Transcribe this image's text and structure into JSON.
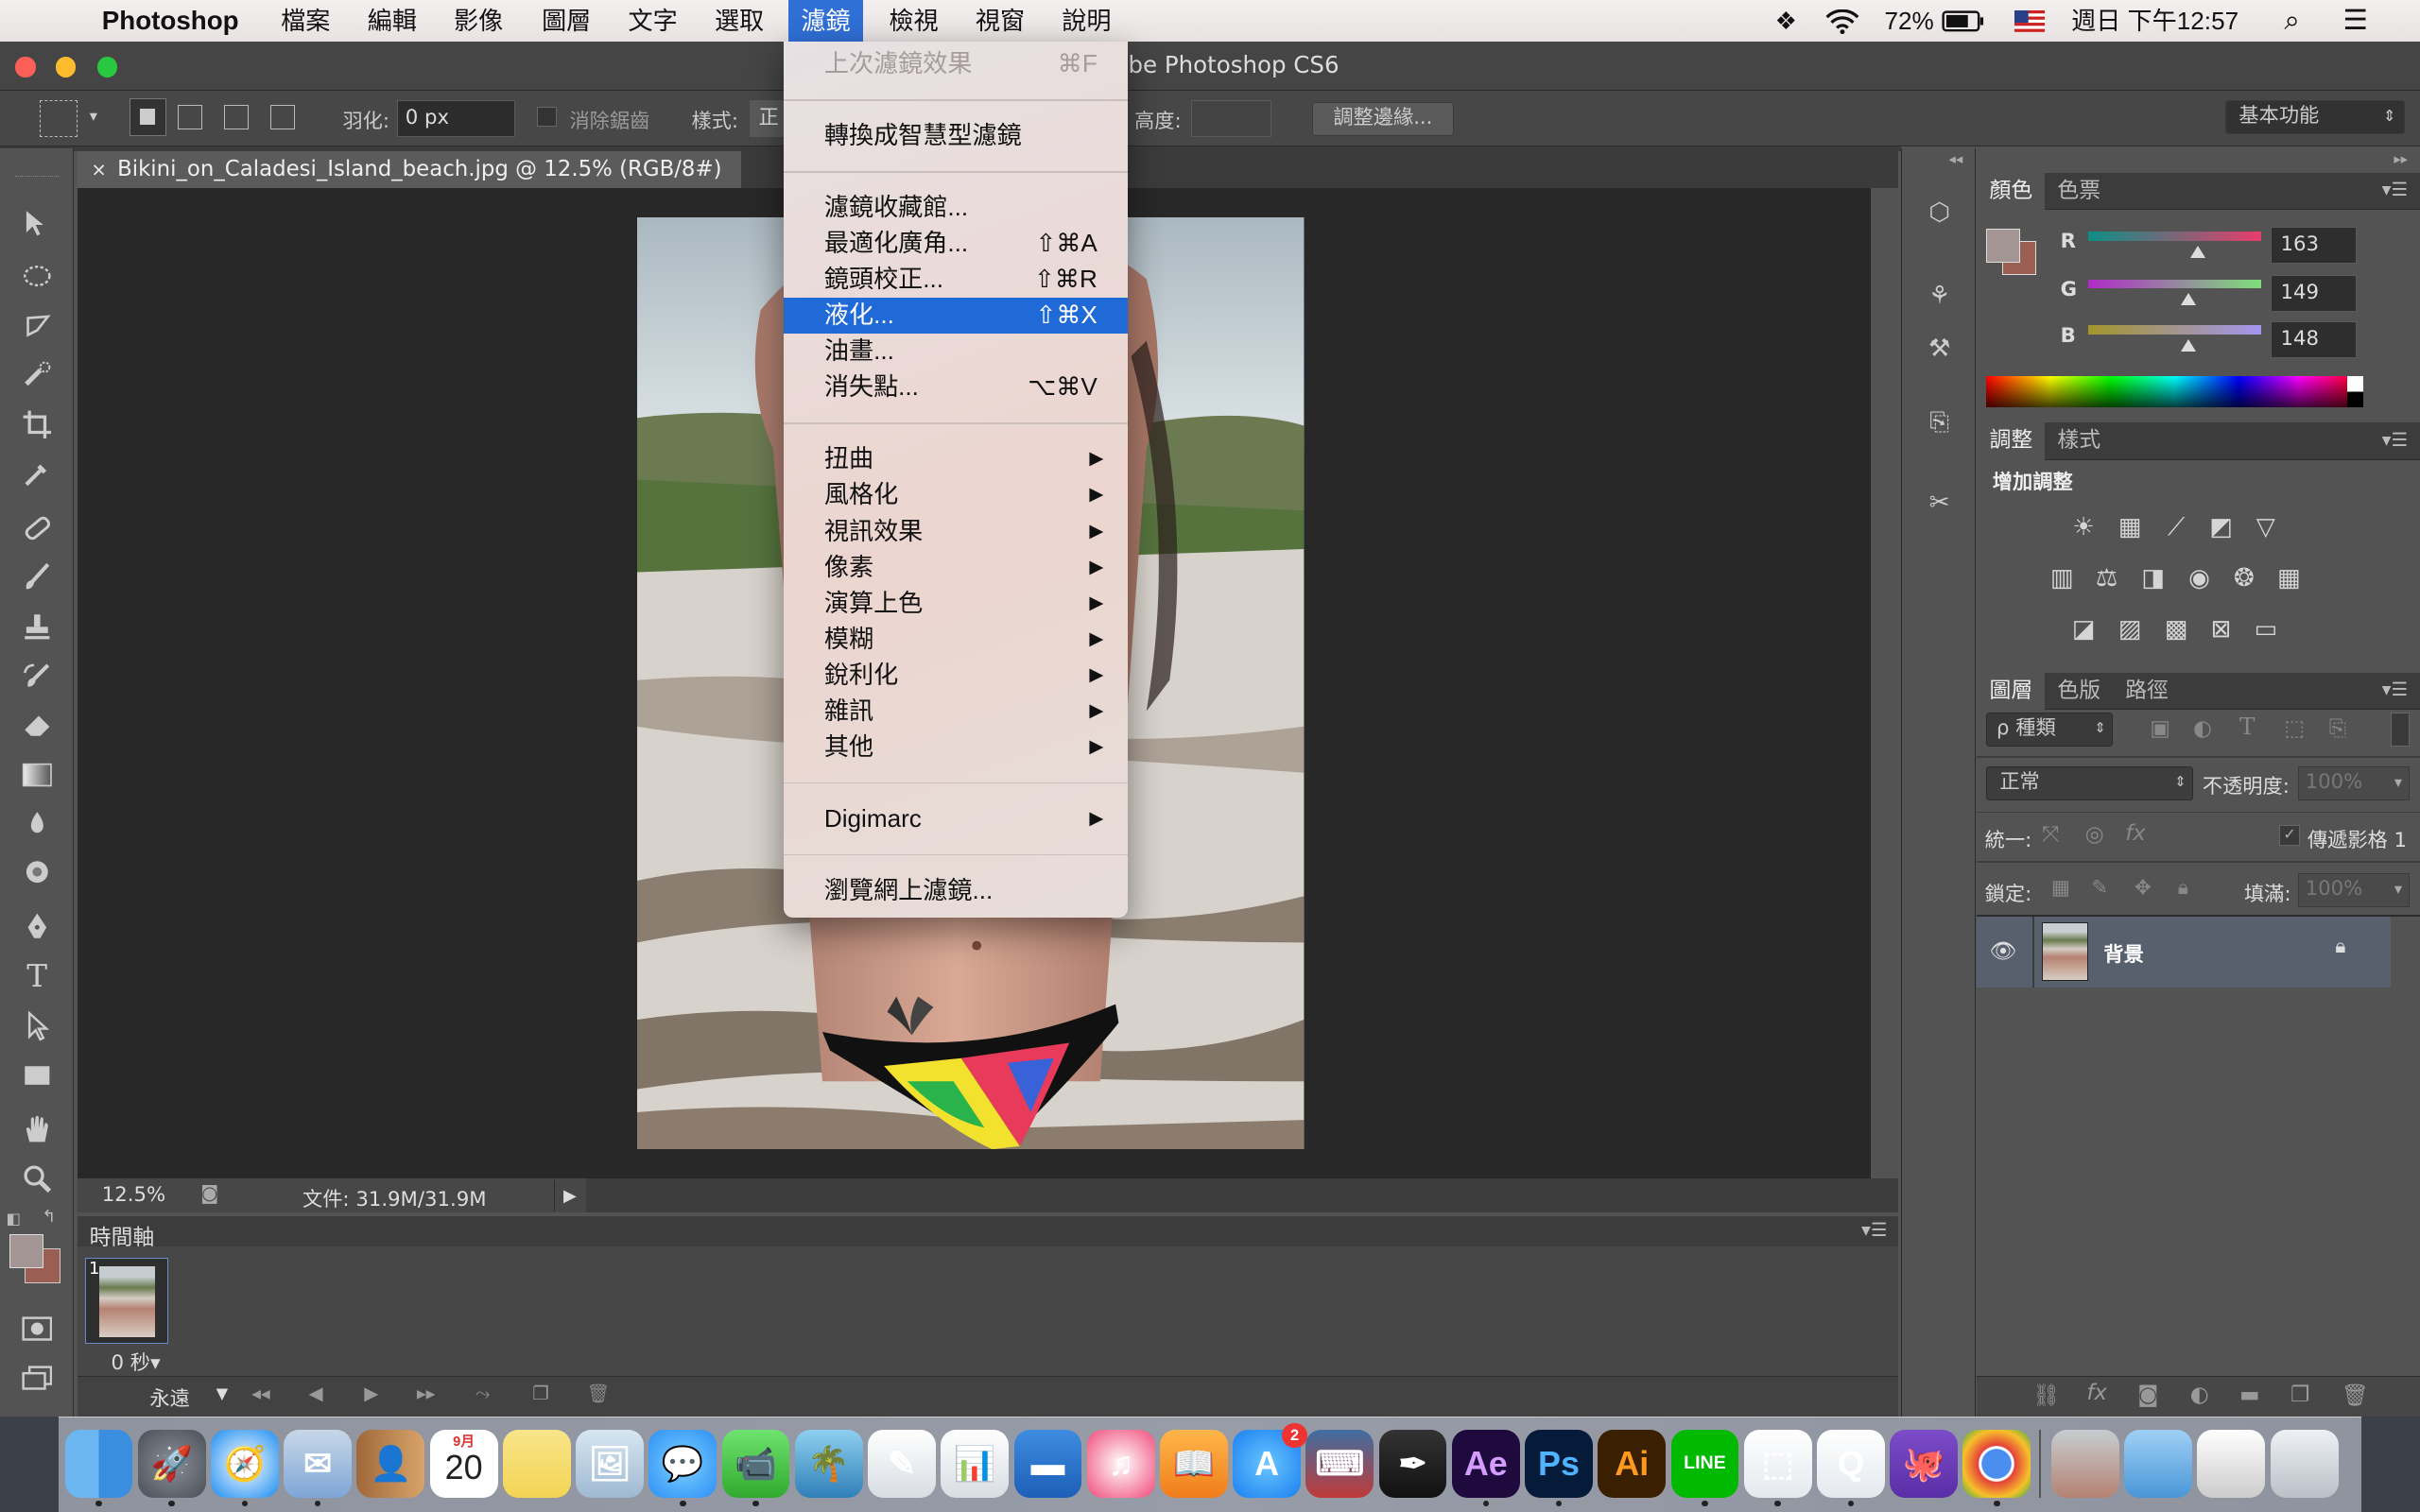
{
  "menubar": {
    "app": "Photoshop",
    "items": [
      "檔案",
      "編輯",
      "影像",
      "圖層",
      "文字",
      "選取",
      "濾鏡",
      "檢視",
      "視窗",
      "說明"
    ],
    "selected_index": 6,
    "battery": "72%",
    "datetime": "週日 下午12:57"
  },
  "window": {
    "title_visible": "be Photoshop CS6"
  },
  "options": {
    "feather_label": "羽化:",
    "feather_value": "0 px",
    "antialias_label": "消除鋸齒",
    "style_label": "樣式:",
    "style_value": "正",
    "height_label": "高度:",
    "refine_button": "調整邊緣...",
    "workspace": "基本功能"
  },
  "document": {
    "tab_label": "Bikini_on_Caladesi_Island_beach.jpg @ 12.5% (RGB/8#)",
    "zoom": "12.5%",
    "doc_size": "文件: 31.9M/31.9M"
  },
  "timeline": {
    "title": "時間軸",
    "frame_number": "1",
    "frame_delay": "0 秒▾",
    "loop": "永遠"
  },
  "filter_menu": {
    "items": [
      {
        "label": "上次濾鏡效果",
        "shortcut": "⌘F",
        "disabled": true
      },
      {
        "sep": true
      },
      {
        "label": "轉換成智慧型濾鏡"
      },
      {
        "sep": true
      },
      {
        "label": "濾鏡收藏館..."
      },
      {
        "label": "最適化廣角...",
        "shortcut": "⇧⌘A"
      },
      {
        "label": "鏡頭校正...",
        "shortcut": "⇧⌘R"
      },
      {
        "label": "液化...",
        "shortcut": "⇧⌘X",
        "highlighted": true
      },
      {
        "label": "油畫..."
      },
      {
        "label": "消失點...",
        "shortcut": "⌥⌘V"
      },
      {
        "sep": true
      },
      {
        "label": "扭曲",
        "submenu": true
      },
      {
        "label": "風格化",
        "submenu": true
      },
      {
        "label": "視訊效果",
        "submenu": true
      },
      {
        "label": "像素",
        "submenu": true
      },
      {
        "label": "演算上色",
        "submenu": true
      },
      {
        "label": "模糊",
        "submenu": true
      },
      {
        "label": "銳利化",
        "submenu": true
      },
      {
        "label": "雜訊",
        "submenu": true
      },
      {
        "label": "其他",
        "submenu": true
      },
      {
        "sep": true
      },
      {
        "label": "Digimarc",
        "submenu": true
      },
      {
        "sep": true
      },
      {
        "label": "瀏覽網上濾鏡..."
      }
    ]
  },
  "color_panel": {
    "tabs": [
      "顏色",
      "色票"
    ],
    "r_label": "R",
    "g_label": "G",
    "b_label": "B",
    "r": "163",
    "g": "149",
    "b": "148",
    "r_fraction": 0.64,
    "g_fraction": 0.58,
    "b_fraction": 0.58,
    "foreground": "#a39594",
    "background": "#9a5f52"
  },
  "adjust_panel": {
    "tabs": [
      "調整",
      "樣式"
    ],
    "heading": "增加調整"
  },
  "layers_panel": {
    "tabs": [
      "圖層",
      "色版",
      "路徑"
    ],
    "kind": "ρ 種類",
    "blend": "正常",
    "opacity_label": "不透明度:",
    "opacity": "100%",
    "unify_label": "統一:",
    "propagate": "傳遞影格 1",
    "lock_label": "鎖定:",
    "fill_label": "填滿:",
    "fill": "100%",
    "layer_name": "背景"
  },
  "dock": {
    "apps": [
      "Finder",
      "Launchpad",
      "Safari",
      "Mail",
      "Contacts",
      "Calendar",
      "Notes",
      "Preview",
      "Messages",
      "FaceTime",
      "iPhoto",
      "Pages",
      "Numbers",
      "Keynote",
      "iTunes",
      "iBooks",
      "App Store",
      "System",
      "Inkscape",
      "Ae",
      "Ps",
      "Ai",
      "LINE",
      "Dropbox",
      "Quick",
      "GitHub",
      "Chrome"
    ],
    "calendar_date": "20",
    "calendar_month": "9月",
    "appstore_badge": "2"
  }
}
